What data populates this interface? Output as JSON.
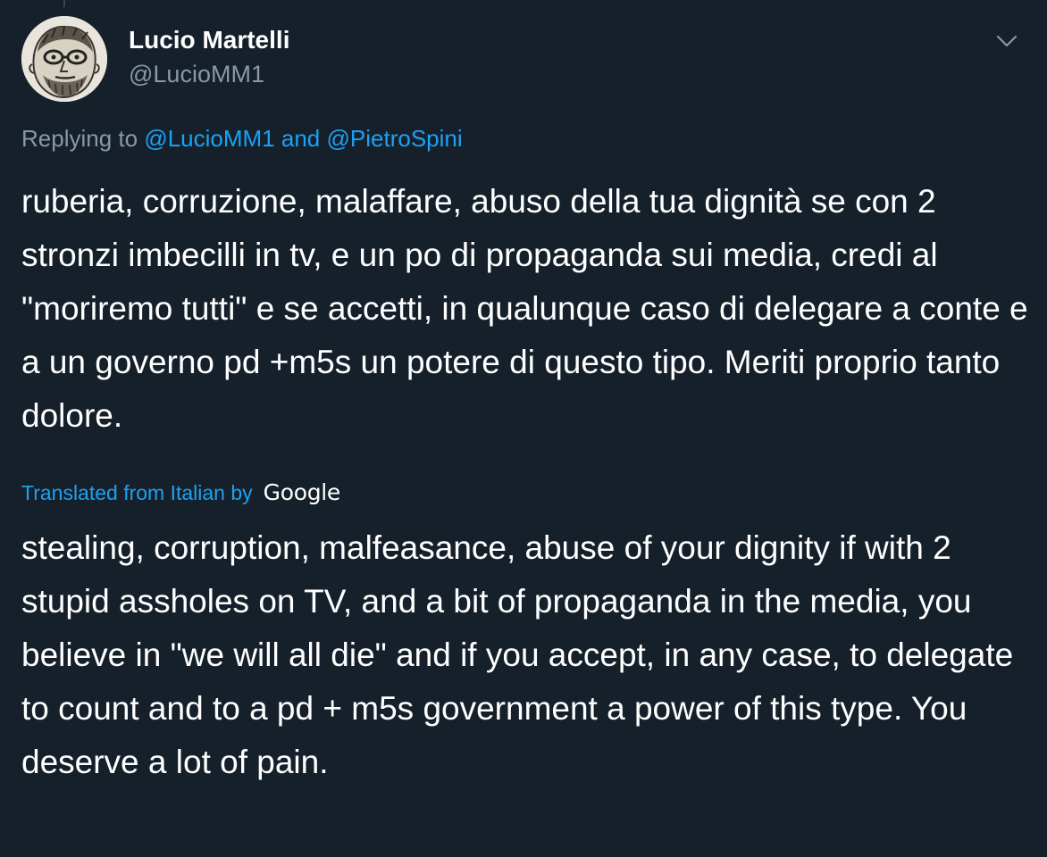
{
  "tweet": {
    "author": {
      "display_name": "Lucio Martelli",
      "handle": "@LucioMM1"
    },
    "replying_to": {
      "prefix": "Replying to",
      "mention_1": "@LucioMM1",
      "conjunction": "and",
      "mention_2": "@PietroSpini"
    },
    "text": "ruberia, corruzione, malaffare, abuso della tua dignità se con 2 stronzi imbecilli in tv, e un po di propaganda sui media, credi al \"moriremo tutti\" e se accetti, in qualunque caso di delegare a conte e a un governo pd +m5s un potere di questo tipo. Meriti proprio tanto dolore.",
    "translation": {
      "label": "Translated from Italian by",
      "provider": "Google",
      "text": "stealing, corruption, malfeasance, abuse of your dignity if with 2 stupid assholes on TV, and a bit of propaganda in the media, you believe in \"we will all die\" and if you accept, in any case, to delegate to count and to a pd + m5s government a power of this type. You deserve a lot of pain."
    }
  },
  "icons": {
    "menu": "chevron-down-icon",
    "avatar": "avatar"
  },
  "colors": {
    "background": "#15202b",
    "text_primary": "#ffffff",
    "text_secondary": "#8899a6",
    "accent": "#1da1f2"
  }
}
